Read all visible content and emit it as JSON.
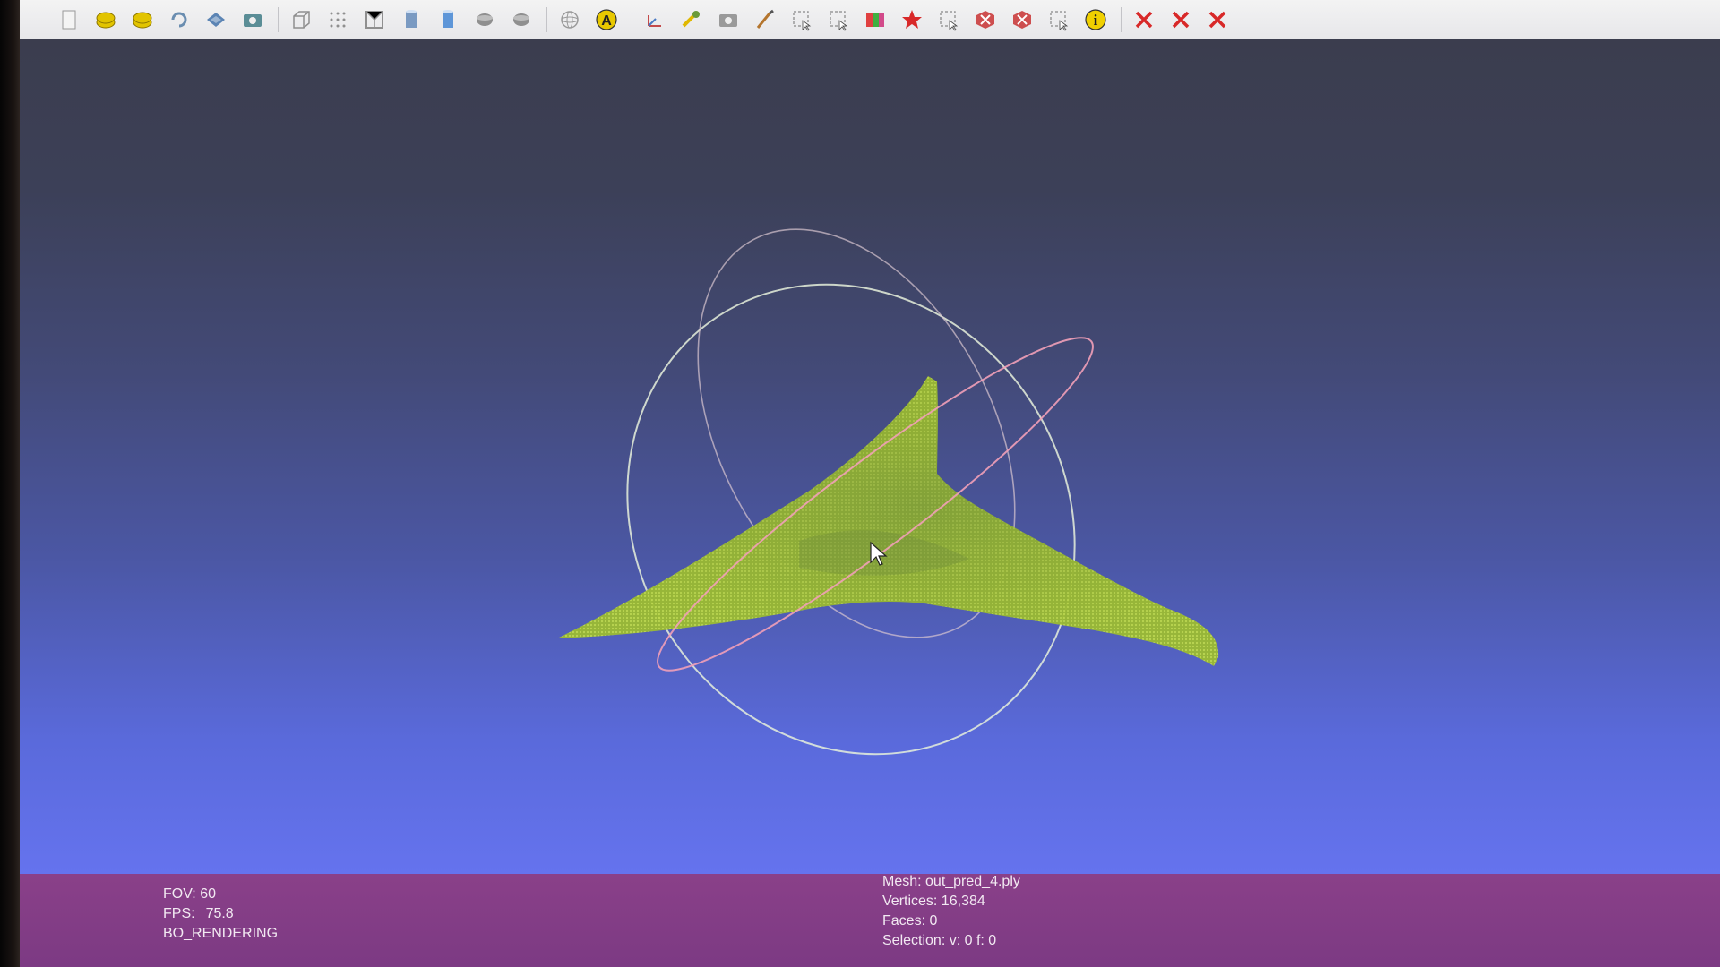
{
  "toolbar": {
    "icons": [
      {
        "name": "new-project-icon",
        "color": "#f4f4f4"
      },
      {
        "name": "open-project-icon",
        "color": "#e2c400"
      },
      {
        "name": "save-project-icon",
        "color": "#e2c400"
      },
      {
        "name": "reload-icon",
        "color": "#6a8db0"
      },
      {
        "name": "layers-icon",
        "color": "#5b84b4"
      },
      {
        "name": "snapshot-icon",
        "color": "#5a8d96"
      },
      {
        "name": "bounding-box-icon",
        "color": "#8f8f8f"
      },
      {
        "name": "points-icon",
        "color": "#8f8f8f"
      },
      {
        "name": "wireframe-icon",
        "color": "#8f8f8f"
      },
      {
        "name": "flat-shading-icon",
        "color": "#7a9ac2"
      },
      {
        "name": "smooth-shading-icon",
        "color": "#5e96d8"
      },
      {
        "name": "texture-icon",
        "color": "#8f8f8f"
      },
      {
        "name": "light-icon",
        "color": "#8f8f8f"
      },
      {
        "name": "trackball-icon",
        "color": "#9a9a9a"
      },
      {
        "name": "annotation-icon",
        "color": "#e8c800"
      },
      {
        "name": "axis-icon",
        "color": "#c44a4a"
      },
      {
        "name": "measure-icon",
        "color": "#e0b800"
      },
      {
        "name": "camera-icon",
        "color": "#9a9a9a"
      },
      {
        "name": "paint-brush-icon",
        "color": "#b4752e"
      },
      {
        "name": "select-vertices-icon",
        "color": "#9a9a9a"
      },
      {
        "name": "select-faces-icon",
        "color": "#9a9a9a"
      },
      {
        "name": "color-palette-icon",
        "color": "#d24a8a"
      },
      {
        "name": "georef-icon",
        "color": "#d82828"
      },
      {
        "name": "select-region-icon",
        "color": "#9a9a9a"
      },
      {
        "name": "delete-faces-icon",
        "color": "#c83232"
      },
      {
        "name": "delete-vertices-icon",
        "color": "#c83232"
      },
      {
        "name": "filter-selection-icon",
        "color": "#9a9a9a"
      },
      {
        "name": "info-icon",
        "color": "#f0d000"
      },
      {
        "name": "remove-faces-icon",
        "color": "#d82828"
      },
      {
        "name": "remove-vertices-icon",
        "color": "#d82828"
      },
      {
        "name": "remove-all-icon",
        "color": "#d82828"
      }
    ]
  },
  "viewport": {
    "mesh_color": "#a8c93a",
    "trackball_colors": {
      "outer": "#e6f0da",
      "inner": "#d9c6d0",
      "horizontal": "#f2a0b8"
    }
  },
  "info": {
    "fov": "FOV: 60",
    "fps_label": "FPS:",
    "fps_value": "75.8",
    "render_mode": "BO_RENDERING",
    "mesh": "Mesh: out_pred_4.ply",
    "vertices": "Vertices: 16,384",
    "faces": "Faces: 0",
    "selection": "Selection: v: 0 f: 0"
  }
}
